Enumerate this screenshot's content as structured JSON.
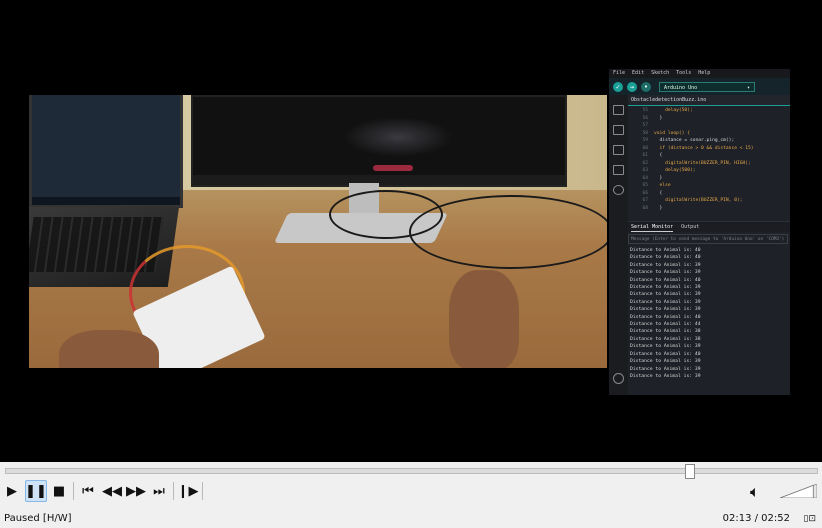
{
  "ide": {
    "menu": [
      "File",
      "Edit",
      "Sketch",
      "Tools",
      "Help"
    ],
    "board": "Arduino Uno",
    "tab": "ObstacledetectionBuzz.ino",
    "code": [
      {
        "n": "55",
        "t": "    delay(50);"
      },
      {
        "n": "56",
        "t": "  }"
      },
      {
        "n": "57",
        "t": ""
      },
      {
        "n": "58",
        "t": "void loop() {"
      },
      {
        "n": "59",
        "t": "  distance = sonar.ping_cm();"
      },
      {
        "n": "60",
        "t": "  if (distance > 0 && distance < 15)"
      },
      {
        "n": "61",
        "t": "  {"
      },
      {
        "n": "62",
        "t": "    digitalWrite(BUZZER_PIN, HIGH);"
      },
      {
        "n": "63",
        "t": "    delay(500);"
      },
      {
        "n": "64",
        "t": "  }"
      },
      {
        "n": "65",
        "t": "  else"
      },
      {
        "n": "66",
        "t": "  {"
      },
      {
        "n": "67",
        "t": "    digitalWrite(BUZZER_PIN, 0);"
      },
      {
        "n": "68",
        "t": "  }"
      }
    ],
    "panel_tabs": [
      "Serial Monitor",
      "Output"
    ],
    "serial_placeholder": "Message (Enter to send message to 'Arduino Uno' on 'COM3')",
    "serial_lines": [
      "Distance to Animal is: 40",
      "Distance to Animal is: 40",
      "Distance to Animal is: 39",
      "Distance to Animal is: 39",
      "Distance to Animal is: 40",
      "Distance to Animal is: 39",
      "Distance to Animal is: 39",
      "Distance to Animal is: 39",
      "Distance to Animal is: 39",
      "Distance to Animal is: 40",
      "Distance to Animal is: 44",
      "Distance to Animal is: 38",
      "Distance to Animal is: 38",
      "Distance to Animal is: 39",
      "Distance to Animal is: 40",
      "Distance to Animal is: 39",
      "Distance to Animal is: 39",
      "Distance to Animal is: 39"
    ]
  },
  "player": {
    "progress": 0.8427,
    "volume": 0.9,
    "status": "Paused [H/W]",
    "time": "02:13 / 02:52"
  },
  "icons": {
    "play": "play-icon",
    "pause": "pause-icon",
    "stop": "stop-icon",
    "skip_back": "skip-back-icon",
    "rewind": "rewind-icon",
    "fast_forward": "fast-forward-icon",
    "skip_forward": "skip-forward-icon",
    "frame_step": "frame-step-icon",
    "volume": "speaker-icon",
    "aspect": "aspect-ratio-icon"
  }
}
